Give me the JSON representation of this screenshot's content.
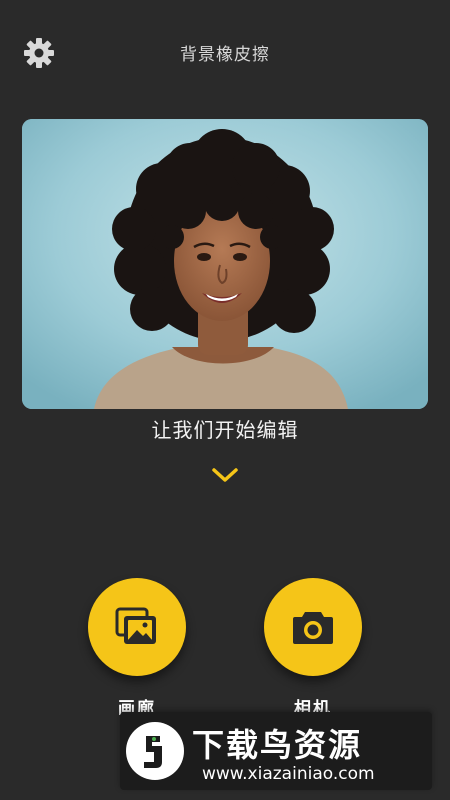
{
  "header": {
    "title": "背景橡皮擦",
    "settings_icon": "gear-icon"
  },
  "hero": {
    "image": "portrait-photo"
  },
  "main": {
    "tagline": "让我们开始编辑",
    "expand_icon": "chevron-down-icon"
  },
  "actions": [
    {
      "label": "画廊",
      "icon": "gallery-icon"
    },
    {
      "label": "相机",
      "icon": "camera-icon"
    }
  ],
  "watermark": {
    "title": "下载鸟资源",
    "url": "www.xiazainiao.com"
  },
  "colors": {
    "background": "#2a2a2a",
    "accent": "#f5c518",
    "chevron": "#f5c518"
  }
}
